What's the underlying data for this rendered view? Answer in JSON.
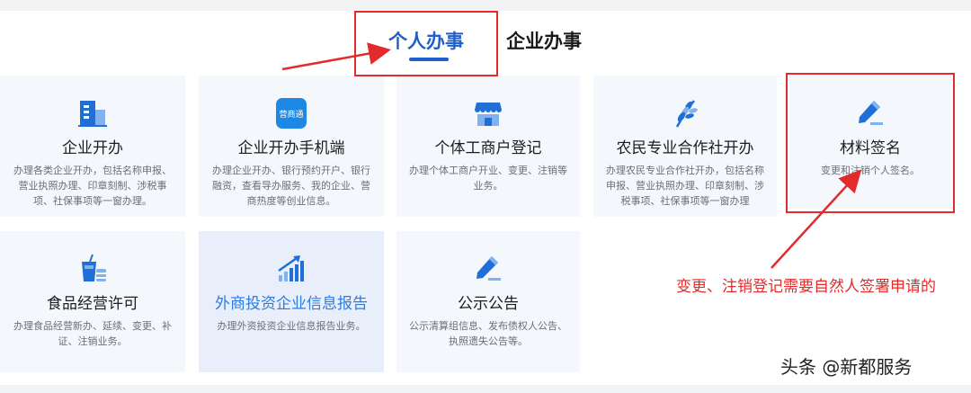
{
  "tabs": [
    {
      "label": "个人办事",
      "active": true
    },
    {
      "label": "企业办事",
      "active": false
    }
  ],
  "colors": {
    "accent": "#1f5fcc",
    "annotation": "#e32b2b",
    "card_bg": "#f4f7fc",
    "hover_title": "#2e7ce0"
  },
  "cards": [
    {
      "icon": "building-icon",
      "title": "企业开办",
      "desc": "办理各类企业开办，包括名称申报、营业执照办理、印章刻制、涉税事项、社保事项等一窗办理。"
    },
    {
      "icon": "app-logo-icon",
      "icon_text": "营商通",
      "title": "企业开办手机端",
      "desc": "办理企业开办、银行预约开户、银行融资，查看导办服务、我的企业、营商热度等创业信息。"
    },
    {
      "icon": "shop-icon",
      "title": "个体工商户登记",
      "desc": "办理个体工商户开业、变更、注销等业务。"
    },
    {
      "icon": "wheat-icon",
      "title": "农民专业合作社开办",
      "desc": "办理农民专业合作社开办，包括名称申报、营业执照办理、印章刻制、涉税事项、社保事项等一窗办理"
    },
    {
      "icon": "pen-sign-icon",
      "title": "材料签名",
      "desc": "变更和注销个人签名。"
    },
    {
      "icon": "drink-icon",
      "title": "食品经营许可",
      "desc": "办理食品经营新办、延续、变更、补证、注销业务。"
    },
    {
      "icon": "chart-growth-icon",
      "title": "外商投资企业信息报告",
      "desc": "办理外资投资企业信息报告业务。"
    },
    {
      "icon": "pen-notice-icon",
      "title": "公示公告",
      "desc": "公示清算组信息、发布债权人公告、执照遗失公告等。"
    }
  ],
  "annotation": "变更、注销登记需要自然人签署申请的",
  "watermark": "头条 @新都服务"
}
